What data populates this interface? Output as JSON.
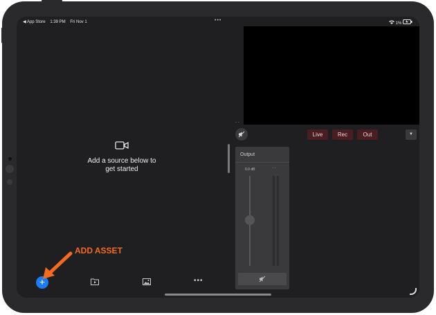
{
  "status_bar": {
    "back_app": "◀ App Store",
    "time": "1:39 PM",
    "date": "Fri Nov 1",
    "more": "•••",
    "battery": "1%"
  },
  "placeholder": {
    "line1": "Add a source below to",
    "line2": "get started"
  },
  "controls": {
    "live": "Live",
    "rec": "Rec",
    "out": "Out",
    "dropdown": "▼"
  },
  "mixer": {
    "title": "Output",
    "db": "0.0 dB",
    "meter_ticks": "- -"
  },
  "toolbar": {
    "add": "+",
    "more": "•••"
  },
  "annotation": {
    "text": "ADD ASSET",
    "color": "#f46a1e"
  },
  "colors": {
    "accent_blue": "#1e7cf2",
    "live_bg": "#4a1d22"
  }
}
